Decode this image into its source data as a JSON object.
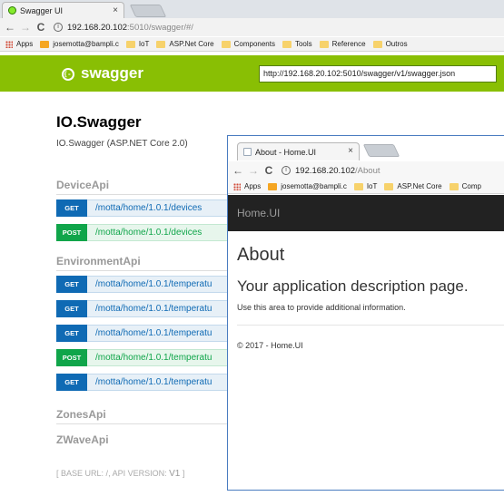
{
  "back_browser": {
    "tab": {
      "title": "Swagger UI",
      "close": "×"
    },
    "toolbar": {
      "back": "←",
      "forward": "→",
      "reload": "C",
      "info": "i",
      "url_host": "192.168.20.102",
      "url_path": ":5010/swagger/#/"
    },
    "bookmarks": {
      "apps": "Apps",
      "items": [
        "josemotta@bampli.c",
        "IoT",
        "ASP.Net Core",
        "Components",
        "Tools",
        "Reference",
        "Outros"
      ]
    }
  },
  "swagger": {
    "logo_text": "swagger",
    "logo_icon": "{-}",
    "url_value": "http://192.168.20.102:5010/swagger/v1/swagger.json",
    "title": "IO.Swagger",
    "description": "IO.Swagger (ASP.NET Core 2.0)",
    "sections": [
      {
        "name": "DeviceApi"
      },
      {
        "name": "EnvironmentApi"
      },
      {
        "name": "ZonesApi"
      },
      {
        "name": "ZWaveApi"
      }
    ],
    "operations": [
      {
        "method": "GET",
        "path": "/motta/home/1.0.1/devices"
      },
      {
        "method": "POST",
        "path": "/motta/home/1.0.1/devices"
      },
      {
        "method": "GET",
        "path": "/motta/home/1.0.1/temperatu"
      },
      {
        "method": "GET",
        "path": "/motta/home/1.0.1/temperatu"
      },
      {
        "method": "GET",
        "path": "/motta/home/1.0.1/temperatu"
      },
      {
        "method": "POST",
        "path": "/motta/home/1.0.1/temperatu"
      },
      {
        "method": "GET",
        "path": "/motta/home/1.0.1/temperatu"
      }
    ],
    "footer": {
      "base_url_label": "BASE URL: /",
      "api_version_label": ", API VERSION:",
      "api_version": "V1",
      "open_bracket": "[",
      "close_bracket": "]"
    },
    "colors": {
      "header": "#89bf04",
      "get": "#0f6ab4",
      "post": "#10a54a"
    }
  },
  "front_browser": {
    "tab": {
      "title": "About - Home.UI",
      "close": "×"
    },
    "toolbar": {
      "back": "←",
      "forward": "→",
      "reload": "C",
      "info": "i",
      "url_host": "192.168.20.102",
      "url_path": "/About"
    },
    "bookmarks": {
      "apps": "Apps",
      "items": [
        "josemotta@bampli.c",
        "IoT",
        "ASP.Net Core",
        "Comp"
      ]
    },
    "page": {
      "brand": "Home.UI",
      "heading": "About",
      "subheading": "Your application description page.",
      "body": "Use this area to provide additional information.",
      "footer": "© 2017 - Home.UI"
    }
  }
}
